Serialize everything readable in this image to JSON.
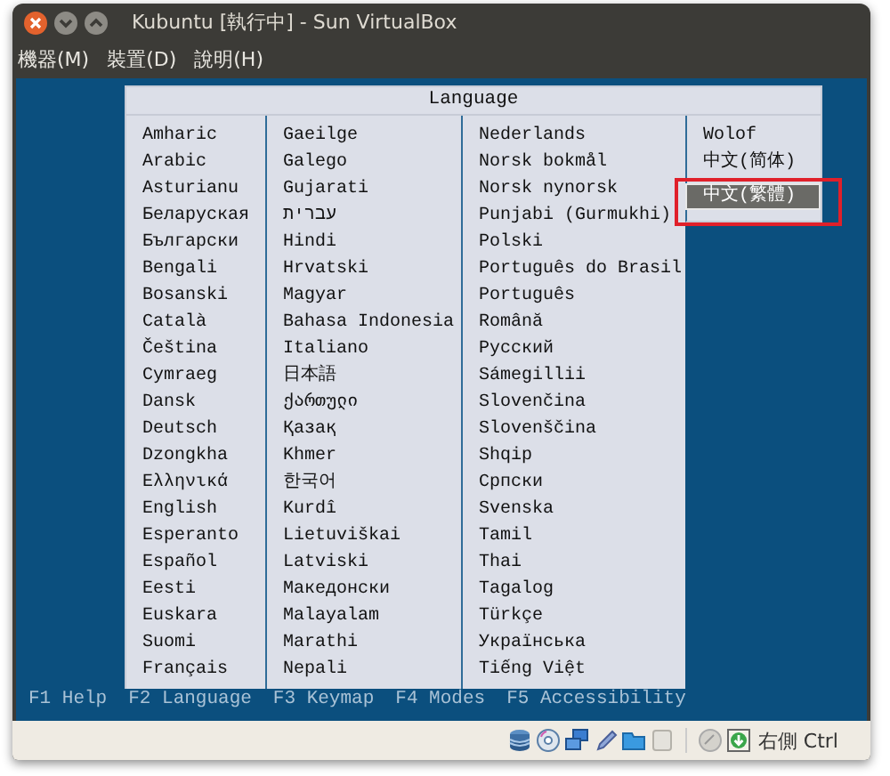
{
  "window": {
    "title": "Kubuntu [執行中] - Sun VirtualBox"
  },
  "menu": [
    "機器(M)",
    "裝置(D)",
    "說明(H)"
  ],
  "dialog": {
    "title": "Language",
    "annotation": {
      "kind": "outline"
    },
    "columns": [
      [
        {
          "label": "Amharic",
          "selected": false
        },
        {
          "label": "Arabic",
          "selected": false
        },
        {
          "label": "Asturianu",
          "selected": false
        },
        {
          "label": "Беларуская",
          "selected": false
        },
        {
          "label": "Български",
          "selected": false
        },
        {
          "label": "Bengali",
          "selected": false
        },
        {
          "label": "Bosanski",
          "selected": false
        },
        {
          "label": "Català",
          "selected": false
        },
        {
          "label": "Čeština",
          "selected": false
        },
        {
          "label": "Cymraeg",
          "selected": false
        },
        {
          "label": "Dansk",
          "selected": false
        },
        {
          "label": "Deutsch",
          "selected": false
        },
        {
          "label": "Dzongkha",
          "selected": false
        },
        {
          "label": "Ελληνικά",
          "selected": false
        },
        {
          "label": "English",
          "selected": false
        },
        {
          "label": "Esperanto",
          "selected": false
        },
        {
          "label": "Español",
          "selected": false
        },
        {
          "label": "Eesti",
          "selected": false
        },
        {
          "label": "Euskara",
          "selected": false
        },
        {
          "label": "Suomi",
          "selected": false
        },
        {
          "label": "Français",
          "selected": false
        }
      ],
      [
        {
          "label": "Gaeilge",
          "selected": false
        },
        {
          "label": "Galego",
          "selected": false
        },
        {
          "label": "Gujarati",
          "selected": false
        },
        {
          "label": "עברית",
          "selected": false
        },
        {
          "label": "Hindi",
          "selected": false
        },
        {
          "label": "Hrvatski",
          "selected": false
        },
        {
          "label": "Magyar",
          "selected": false
        },
        {
          "label": "Bahasa Indonesia",
          "selected": false
        },
        {
          "label": "Italiano",
          "selected": false
        },
        {
          "label": "日本語",
          "selected": false
        },
        {
          "label": "ქართული",
          "selected": false
        },
        {
          "label": "Қазақ",
          "selected": false
        },
        {
          "label": "Khmer",
          "selected": false
        },
        {
          "label": "한국어",
          "selected": false
        },
        {
          "label": "Kurdî",
          "selected": false
        },
        {
          "label": "Lietuviškai",
          "selected": false
        },
        {
          "label": "Latviski",
          "selected": false
        },
        {
          "label": "Македонски",
          "selected": false
        },
        {
          "label": "Malayalam",
          "selected": false
        },
        {
          "label": "Marathi",
          "selected": false
        },
        {
          "label": "Nepali",
          "selected": false
        }
      ],
      [
        {
          "label": "Nederlands",
          "selected": false
        },
        {
          "label": "Norsk bokmål",
          "selected": false
        },
        {
          "label": "Norsk nynorsk",
          "selected": false
        },
        {
          "label": "Punjabi (Gurmukhi)",
          "selected": false
        },
        {
          "label": "Polski",
          "selected": false
        },
        {
          "label": "Português do Brasil",
          "selected": false
        },
        {
          "label": "Português",
          "selected": false
        },
        {
          "label": "Română",
          "selected": false
        },
        {
          "label": "Русский",
          "selected": false
        },
        {
          "label": "Sámegillii",
          "selected": false
        },
        {
          "label": "Slovenčina",
          "selected": false
        },
        {
          "label": "Slovenščina",
          "selected": false
        },
        {
          "label": "Shqip",
          "selected": false
        },
        {
          "label": "Српски",
          "selected": false
        },
        {
          "label": "Svenska",
          "selected": false
        },
        {
          "label": "Tamil",
          "selected": false
        },
        {
          "label": "Thai",
          "selected": false
        },
        {
          "label": "Tagalog",
          "selected": false
        },
        {
          "label": "Türkçe",
          "selected": false
        },
        {
          "label": "Українська",
          "selected": false
        },
        {
          "label": "Tiếng Việt",
          "selected": false
        }
      ],
      [
        {
          "label": "Wolof",
          "selected": false
        },
        {
          "label": "中文(简体)",
          "selected": false
        },
        {
          "label": "中文(繁體)",
          "selected": true
        }
      ]
    ]
  },
  "function_keys": [
    {
      "key": "F1",
      "label": "Help"
    },
    {
      "key": "F2",
      "label": "Language"
    },
    {
      "key": "F3",
      "label": "Keymap"
    },
    {
      "key": "F4",
      "label": "Modes"
    },
    {
      "key": "F5",
      "label": "Accessibility"
    }
  ],
  "status_bar": {
    "host_key": "右側 Ctrl"
  }
}
